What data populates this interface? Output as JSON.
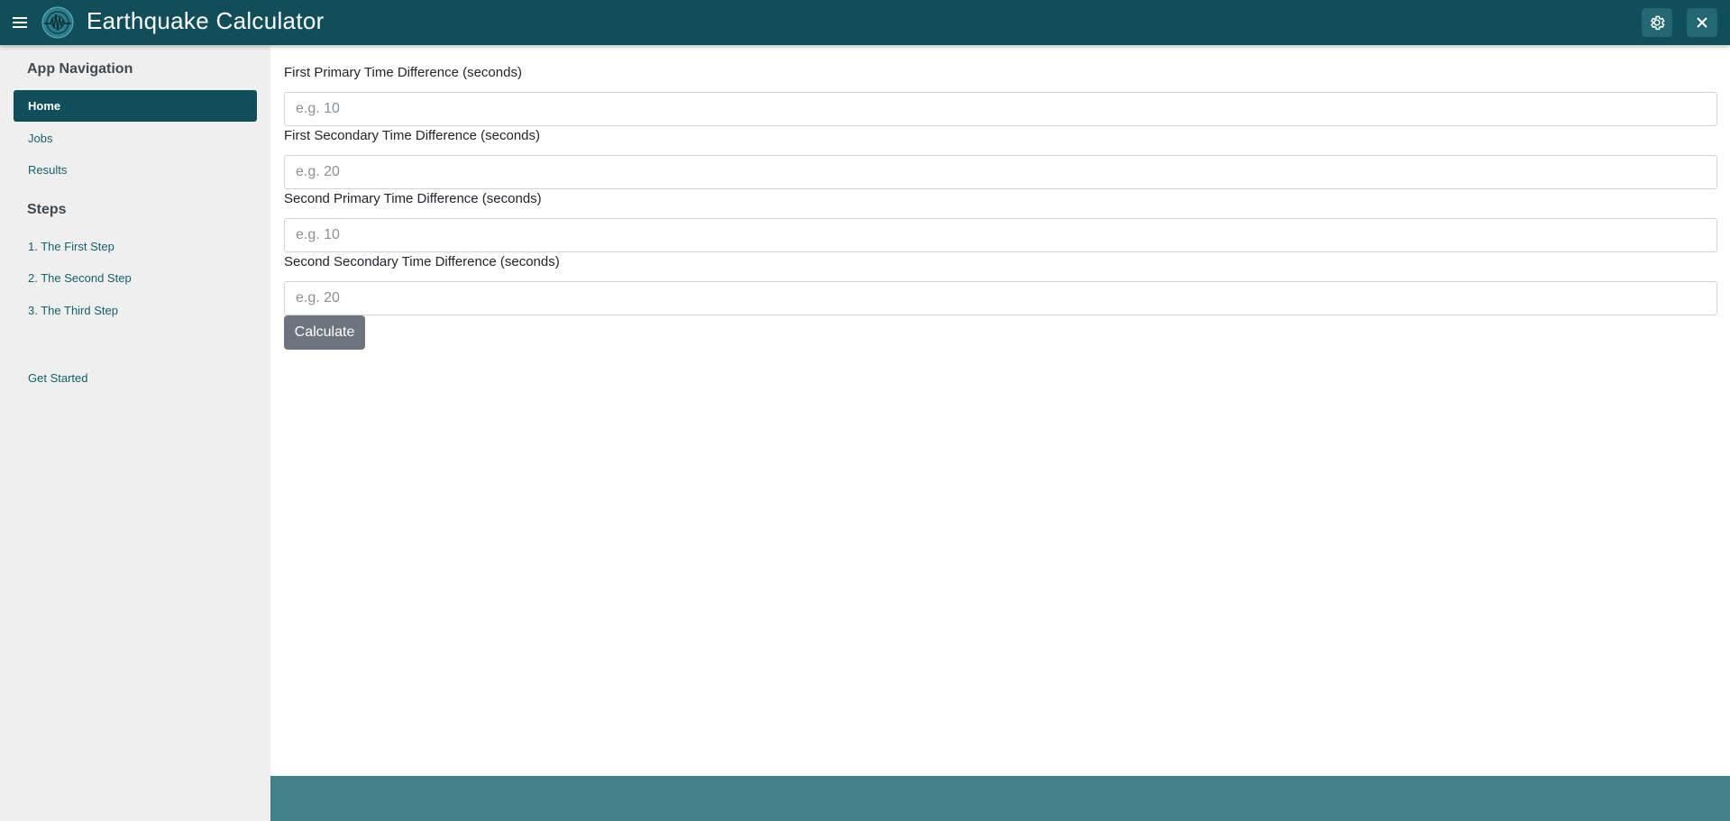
{
  "header": {
    "title": "Earthquake Calculator",
    "menu_icon": "hamburger-menu-icon",
    "logo_icon": "seismograph-logo-icon",
    "settings_icon": "gear-icon",
    "close_icon": "close-icon",
    "bg_color": "#114e5a"
  },
  "sidebar": {
    "nav_heading": "App Navigation",
    "nav_items": [
      {
        "label": "Home",
        "active": true
      },
      {
        "label": "Jobs",
        "active": false
      },
      {
        "label": "Results",
        "active": false
      }
    ],
    "steps_heading": "Steps",
    "steps_items": [
      {
        "label": "1. The First Step"
      },
      {
        "label": "2. The Second Step"
      },
      {
        "label": "3. The Third Step"
      }
    ],
    "get_started": "Get Started"
  },
  "form": {
    "fields": [
      {
        "label": "First Primary Time Difference (seconds)",
        "placeholder": "e.g. 10",
        "value": ""
      },
      {
        "label": "First Secondary Time Difference (seconds)",
        "placeholder": "e.g. 20",
        "value": ""
      },
      {
        "label": "Second Primary Time Difference (seconds)",
        "placeholder": "e.g. 10",
        "value": ""
      },
      {
        "label": "Second Secondary Time Difference (seconds)",
        "placeholder": "e.g. 20",
        "value": ""
      }
    ],
    "submit_label": "Calculate"
  },
  "footer": {
    "bg_color": "#438189"
  }
}
